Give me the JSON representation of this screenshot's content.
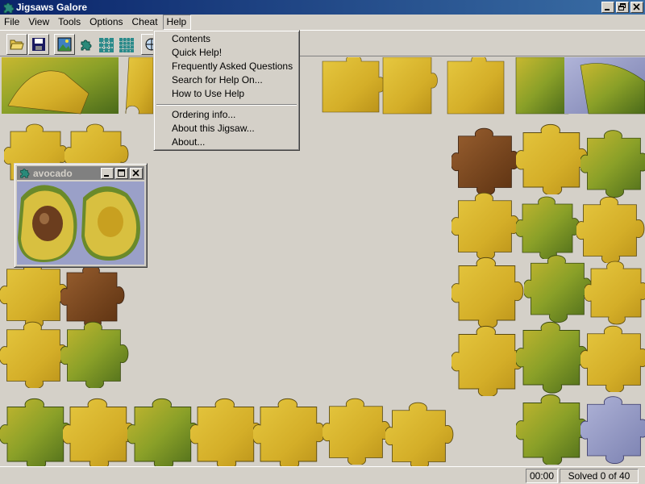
{
  "window": {
    "title": "Jigsaws Galore"
  },
  "menu": [
    {
      "label": "File"
    },
    {
      "label": "View"
    },
    {
      "label": "Tools"
    },
    {
      "label": "Options"
    },
    {
      "label": "Cheat"
    },
    {
      "label": "Help"
    }
  ],
  "help_menu": {
    "items": [
      "Contents",
      "Quick Help!",
      "Frequently Asked Questions",
      "Search for Help On...",
      "How to Use Help",
      "Ordering info...",
      "About this Jigsaw...",
      "About..."
    ]
  },
  "preview": {
    "title": "avocado"
  },
  "status": {
    "timer": "00:00",
    "solved": "Solved 0 of 40"
  },
  "colors": {
    "titlebar": "#0a246a",
    "avocado_yellow": "#d8b62a",
    "avocado_green": "#7a9a2a",
    "pit_brown": "#6b3d1e"
  }
}
